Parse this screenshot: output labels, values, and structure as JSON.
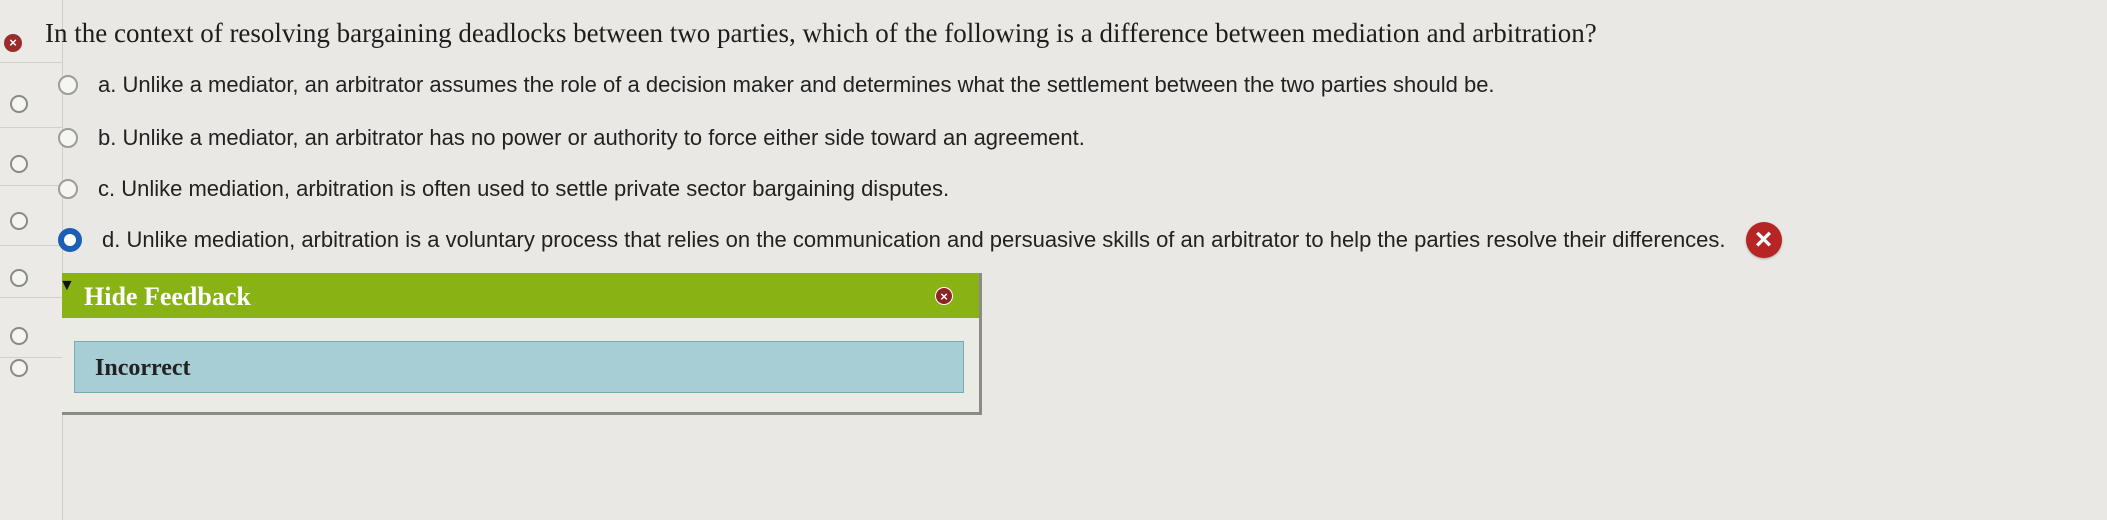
{
  "question": {
    "text": "In the context of resolving bargaining deadlocks between two parties, which of the following is a difference between mediation and arbitration?",
    "status_icon": "error-icon"
  },
  "options": [
    {
      "label": "a. Unlike a mediator, an arbitrator assumes the role of a decision maker and determines what the settlement between the two parties should be.",
      "selected": false
    },
    {
      "label": "b. Unlike a mediator, an arbitrator has no power or authority to force either side toward an agreement.",
      "selected": false
    },
    {
      "label": "c. Unlike mediation, arbitration is often used to settle private sector bargaining disputes.",
      "selected": false
    },
    {
      "label": "d. Unlike mediation, arbitration is a voluntary process that relies on the communication and persuasive skills of an arbitrator to help the parties resolve their differences.",
      "selected": true,
      "marked_incorrect": true
    }
  ],
  "feedback": {
    "toggle_icon": "▼",
    "title": "Hide Feedback",
    "result": "Incorrect",
    "close_icon": "close-icon"
  },
  "colors": {
    "header_green": "#89b314",
    "result_blue": "#a7cdd5",
    "selected_radio": "#1d5fb5",
    "error_red": "#b62424"
  }
}
